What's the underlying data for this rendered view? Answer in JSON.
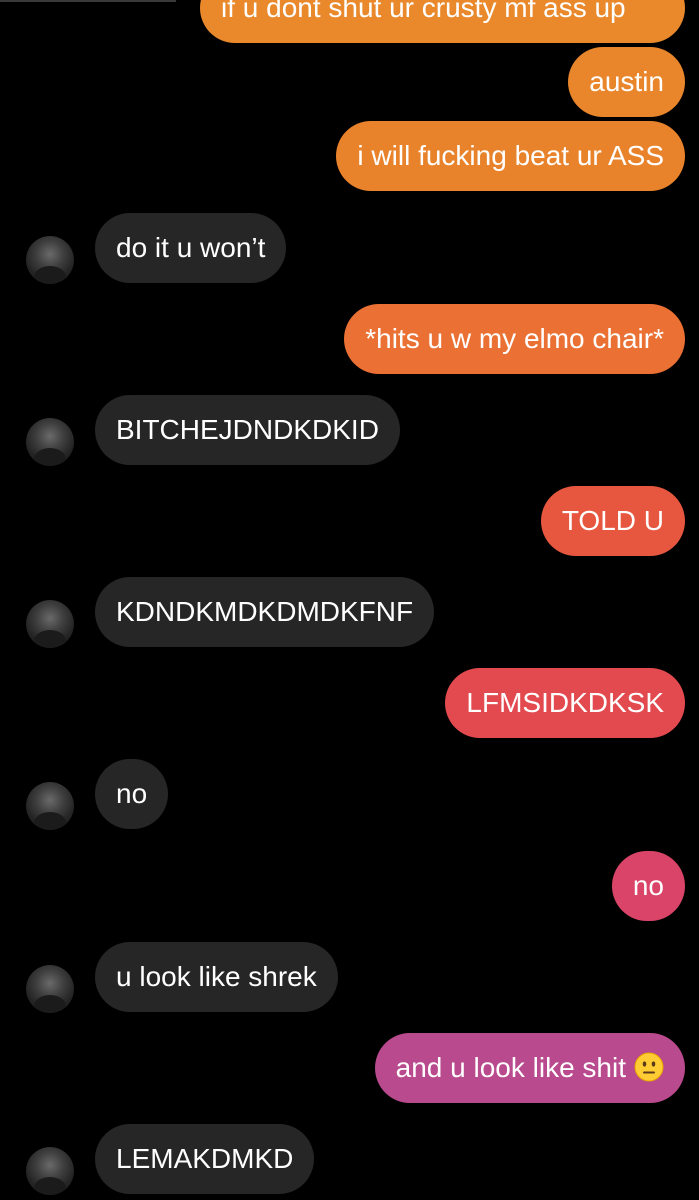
{
  "conversation": {
    "messages": [
      {
        "sender": "me",
        "text": "if u dont shut ur crusty mf ass up",
        "color": "#E9892B"
      },
      {
        "sender": "me",
        "text": "austin",
        "color": "#E9862B"
      },
      {
        "sender": "me",
        "text": "i will fucking beat ur ASS",
        "color": "#E9832B"
      },
      {
        "sender": "them",
        "text": "do it u won’t"
      },
      {
        "sender": "me",
        "text": "*hits u w my elmo chair*",
        "color": "#EA7034"
      },
      {
        "sender": "them",
        "text": "BITCHEJDNDKDKID"
      },
      {
        "sender": "me",
        "text": "TOLD U",
        "color": "#E7573F"
      },
      {
        "sender": "them",
        "text": "KDNDKMDKDMDKFNF"
      },
      {
        "sender": "me",
        "text": "LFMSIDKDKSK",
        "color": "#E34A4F"
      },
      {
        "sender": "them",
        "text": "no"
      },
      {
        "sender": "me",
        "text": "no",
        "color": "#D94468"
      },
      {
        "sender": "them",
        "text": "u look like shrek"
      },
      {
        "sender": "me",
        "text": "and u look like shit",
        "color": "#B94A8E",
        "emoji": "neutral-face-emoji"
      },
      {
        "sender": "them",
        "text": "LEMAKDMKD"
      }
    ]
  },
  "colors": {
    "background": "#000000",
    "incoming_bubble": "#262626",
    "text": "#FFFFFF"
  }
}
